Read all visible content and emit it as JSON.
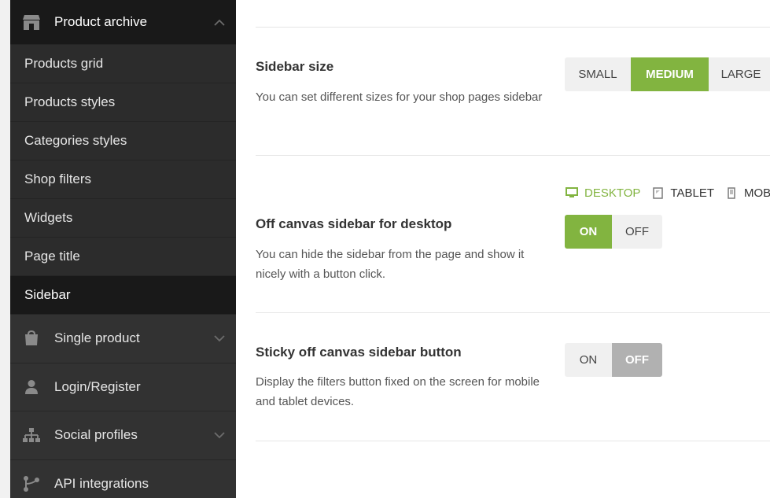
{
  "sidebar": {
    "section": {
      "label": "Product archive",
      "icon": "store-icon",
      "chevron": "chevron-up-icon"
    },
    "sub_items": [
      {
        "label": "Products grid",
        "active": false
      },
      {
        "label": "Products styles",
        "active": false
      },
      {
        "label": "Categories styles",
        "active": false
      },
      {
        "label": "Shop filters",
        "active": false
      },
      {
        "label": "Widgets",
        "active": false
      },
      {
        "label": "Page title",
        "active": false
      },
      {
        "label": "Sidebar",
        "active": true
      }
    ],
    "menu": [
      {
        "label": "Single product",
        "icon": "shopping-bag-icon",
        "has_chevron": true
      },
      {
        "label": "Login/Register",
        "icon": "user-icon",
        "has_chevron": false
      },
      {
        "label": "Social profiles",
        "icon": "sitemap-icon",
        "has_chevron": true
      },
      {
        "label": "API integrations",
        "icon": "integration-icon",
        "has_chevron": false
      }
    ]
  },
  "settings": {
    "sidebar_size": {
      "title": "Sidebar size",
      "description": "You can set different sizes for your shop pages sidebar",
      "options": [
        "SMALL",
        "MEDIUM",
        "LARGE"
      ],
      "selected": "MEDIUM"
    },
    "off_canvas": {
      "title": "Off canvas sidebar for desktop",
      "description": "You can hide the sidebar from the page and show it nicely with a button click.",
      "devices": [
        "DESKTOP",
        "TABLET",
        "MOBILE"
      ],
      "active_device": "DESKTOP",
      "on_label": "ON",
      "off_label": "OFF",
      "value": "ON"
    },
    "sticky_button": {
      "title": "Sticky off canvas sidebar button",
      "description": "Display the filters button fixed on the screen for mobile and tablet devices.",
      "on_label": "ON",
      "off_label": "OFF",
      "value": "OFF"
    }
  },
  "colors": {
    "accent": "#82b440",
    "sidebar_bg": "#323232",
    "sidebar_active_bg": "#191919"
  }
}
